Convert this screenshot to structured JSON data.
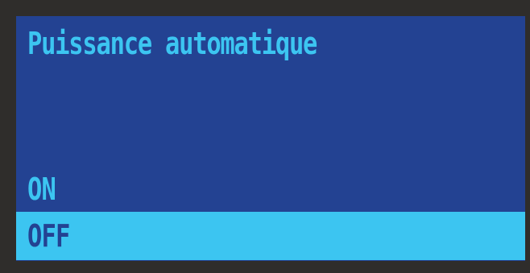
{
  "screen": {
    "title": "Puissance automatique",
    "options": [
      {
        "label": "ON",
        "selected": false
      },
      {
        "label": "OFF",
        "selected": true
      }
    ]
  },
  "colors": {
    "background": "#234292",
    "text": "#3cc5f1",
    "highlight": "#3cc5f1",
    "highlight_text": "#234292",
    "bezel": "#2f2d2b"
  }
}
